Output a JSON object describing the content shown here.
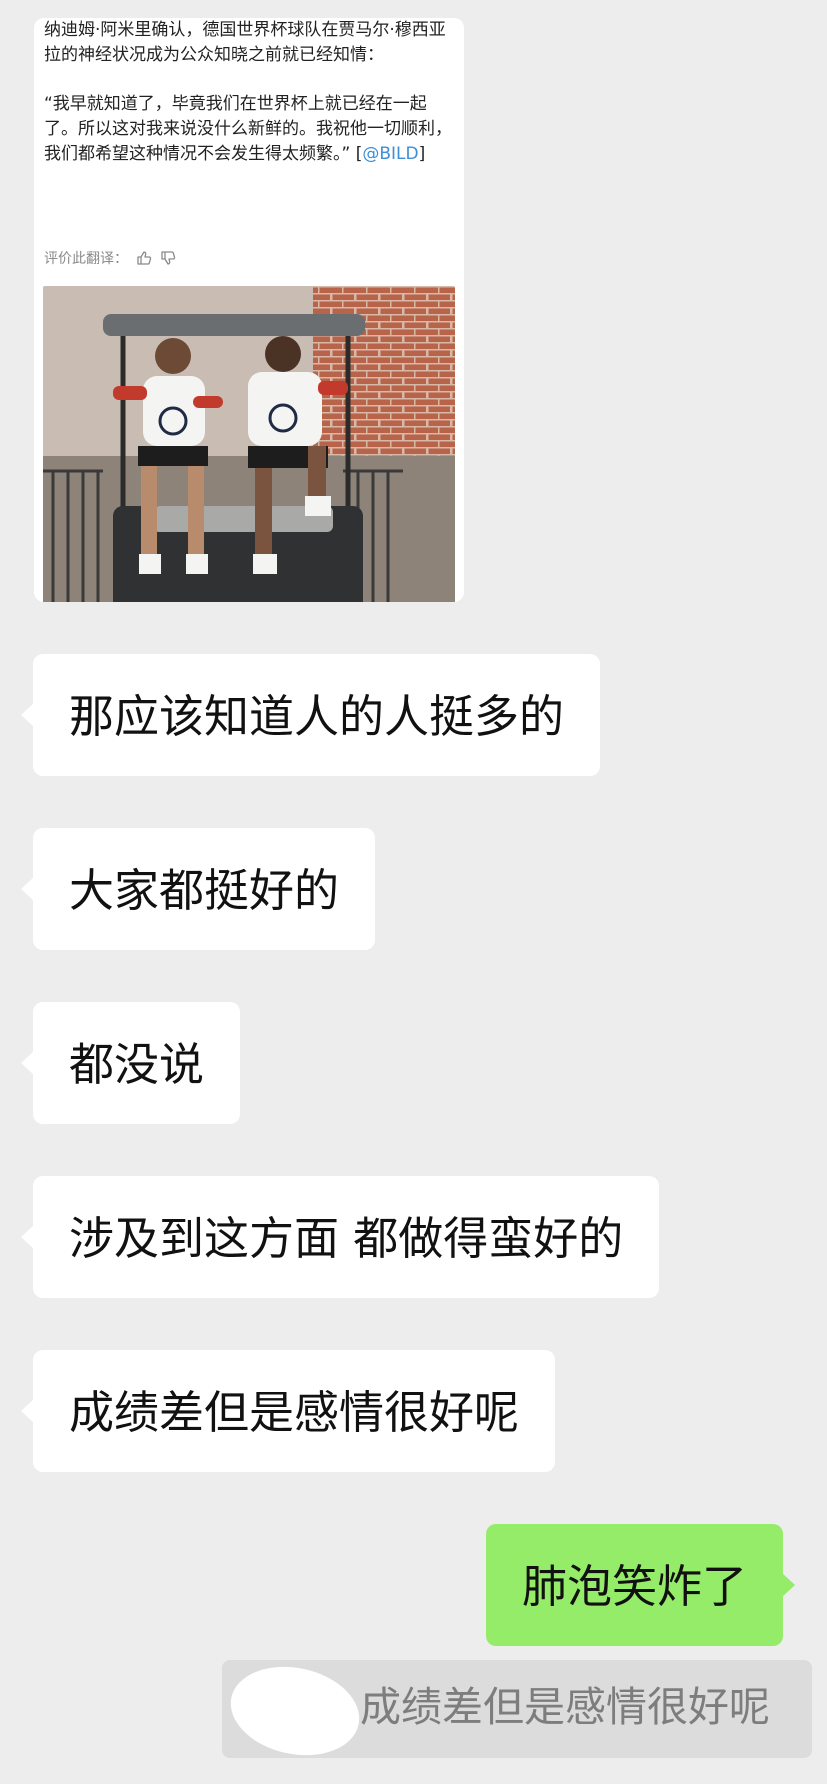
{
  "shared_post": {
    "paragraph_1": "纳迪姆·阿米里确认，德国世界杯球队在贾马尔·穆西亚拉的神经状况成为公众知晓之前就已经知情：",
    "paragraph_2": "“我早就知道了，毕竟我们在世界杯上就已经在一起了。所以这对我来说没什么新鲜的。我祝他一切顺利，我们都希望这种情况不会发生得太频繁。” [",
    "source_link": "@BILD",
    "paragraph_2_end": "]",
    "rate_label": "评价此翻译：",
    "thumbs_up_icon": "thumbs-up-icon",
    "thumbs_down_icon": "thumbs-down-icon"
  },
  "messages": [
    {
      "side": "left",
      "text": "那应该知道人的人挺多的"
    },
    {
      "side": "left",
      "text": "大家都挺好的"
    },
    {
      "side": "left",
      "text": "都没说"
    },
    {
      "side": "left",
      "text": "涉及到这方面 都做得蛮好的"
    },
    {
      "side": "left",
      "text": "成绩差但是感情很好呢"
    },
    {
      "side": "right",
      "text": "肺泡笑炸了"
    }
  ],
  "quote": {
    "text": "成绩差但是感情很好呢"
  },
  "colors": {
    "background": "#ededed",
    "incoming_bubble": "#ffffff",
    "outgoing_bubble": "#95ec69",
    "quote_bar": "#dcdcdc",
    "link": "#3c8fd6"
  }
}
